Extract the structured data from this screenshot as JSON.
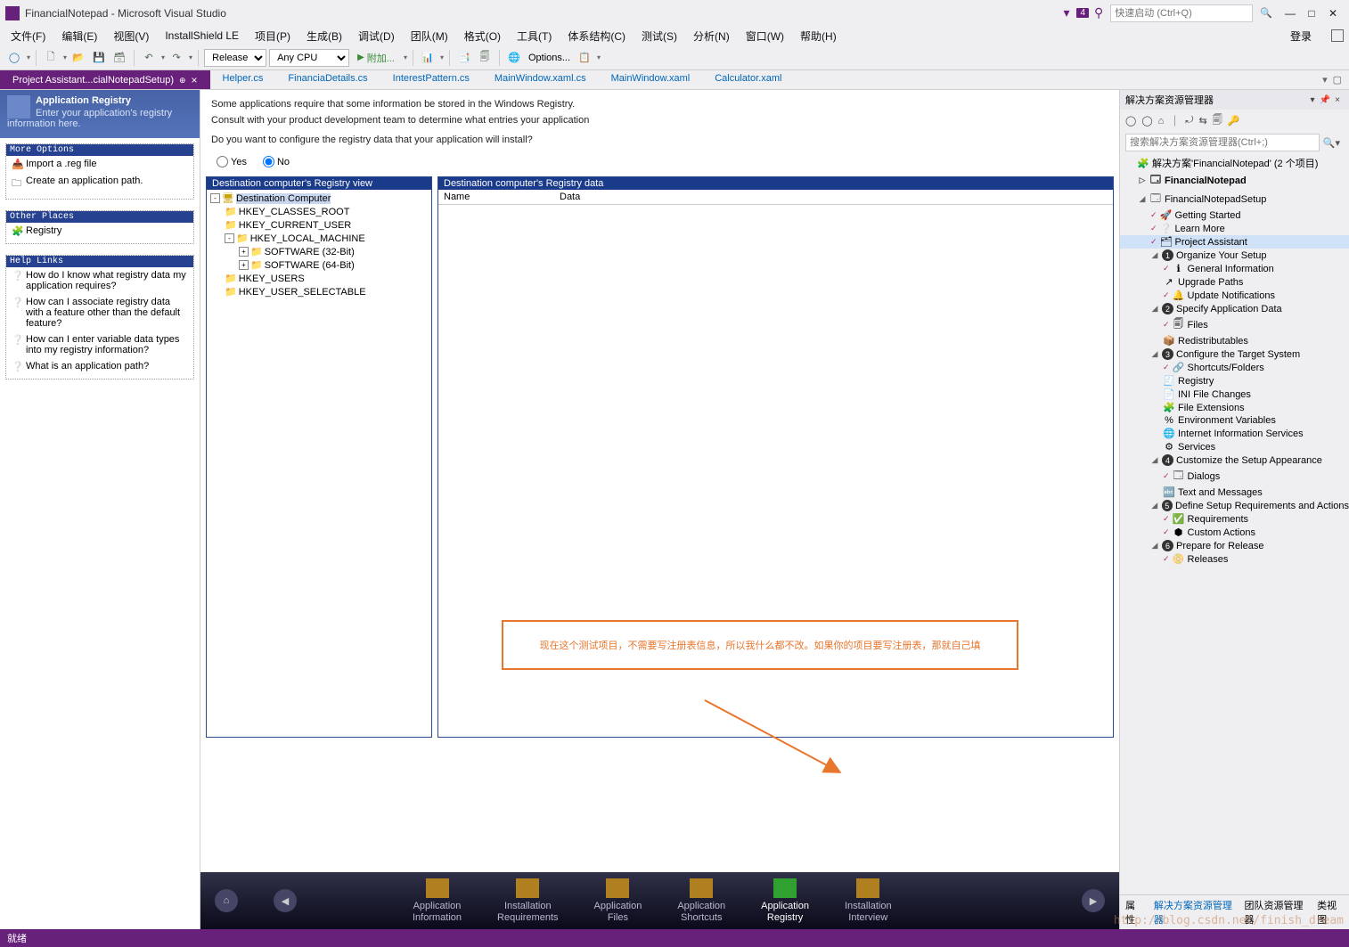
{
  "titlebar": {
    "title": "FinancialNotepad - Microsoft Visual Studio",
    "badge": "4",
    "quicklaunch_placeholder": "快速启动 (Ctrl+Q)"
  },
  "menu": {
    "items": [
      "文件(F)",
      "编辑(E)",
      "视图(V)",
      "InstallShield LE",
      "项目(P)",
      "生成(B)",
      "调试(D)",
      "团队(M)",
      "格式(O)",
      "工具(T)",
      "体系结构(C)",
      "测试(S)",
      "分析(N)",
      "窗口(W)",
      "帮助(H)"
    ],
    "login": "登录"
  },
  "toolbar": {
    "config": "Release",
    "platform": "Any CPU",
    "start": "附加...",
    "options": "Options..."
  },
  "tabs": {
    "active": "Project Assistant...cialNotepadSetup)",
    "others": [
      "Helper.cs",
      "FinanciaDetails.cs",
      "InterestPattern.cs",
      "MainWindow.xaml.cs",
      "MainWindow.xaml",
      "Calculator.xaml"
    ]
  },
  "left": {
    "banner_title": "Application Registry",
    "banner_desc": "Enter your application's registry information here.",
    "more_h": "More Options",
    "more_items": [
      "Import a .reg file",
      "Create an application path."
    ],
    "other_h": "Other Places",
    "other_items": [
      "Registry"
    ],
    "help_h": "Help Links",
    "help_items": [
      "How do I know what registry data my application requires?",
      "How can I associate registry data with a feature other than the default feature?",
      "How can I enter variable data types into my registry information?",
      "What is an application path?"
    ]
  },
  "center": {
    "para1": "Some applications require that some information be stored in the Windows Registry.",
    "para2": "Consult with your product development team to determine what entries your application",
    "question": "Do you want to configure the registry data that your application will install?",
    "yes": "Yes",
    "no": "No",
    "pane1_h": "Destination computer's Registry view",
    "pane2_h": "Destination computer's Registry data",
    "col_name": "Name",
    "col_data": "Data",
    "tree": {
      "root": "Destination Computer",
      "k1": "HKEY_CLASSES_ROOT",
      "k2": "HKEY_CURRENT_USER",
      "k3": "HKEY_LOCAL_MACHINE",
      "k3a": "SOFTWARE (32-Bit)",
      "k3b": "SOFTWARE (64-Bit)",
      "k4": "HKEY_USERS",
      "k5": "HKEY_USER_SELECTABLE"
    },
    "annotation": "现在这个测试项目，不需要写注册表信息，所以我什么都不改。如果你的项目要写注册表，那就自己填"
  },
  "steps": {
    "s1a": "Application",
    "s1b": "Information",
    "s2a": "Installation",
    "s2b": "Requirements",
    "s3a": "Application",
    "s3b": "Files",
    "s4a": "Application",
    "s4b": "Shortcuts",
    "s5a": "Application",
    "s5b": "Registry",
    "s6a": "Installation",
    "s6b": "Interview"
  },
  "right": {
    "title": "解决方案资源管理器",
    "search_placeholder": "搜索解决方案资源管理器(Ctrl+;)",
    "sol": "解决方案'FinancialNotepad' (2 个项目)",
    "proj1": "FinancialNotepad",
    "proj2": "FinancialNotepadSetup",
    "n_getstart": "Getting Started",
    "n_learn": "Learn More",
    "n_pa": "Project Assistant",
    "g1": "Organize Your Setup",
    "g1a": "General Information",
    "g1b": "Upgrade Paths",
    "g1c": "Update Notifications",
    "g2": "Specify Application Data",
    "g2a": "Files",
    "g2b": "Redistributables",
    "g3": "Configure the Target System",
    "g3a": "Shortcuts/Folders",
    "g3b": "Registry",
    "g3c": "INI File Changes",
    "g3d": "File Extensions",
    "g3e": "Environment Variables",
    "g3f": "Internet Information Services",
    "g3g": "Services",
    "g4": "Customize the Setup Appearance",
    "g4a": "Dialogs",
    "g4b": "Text and Messages",
    "g5": "Define Setup Requirements and Actions",
    "g5a": "Requirements",
    "g5b": "Custom Actions",
    "g6": "Prepare for Release",
    "g6a": "Releases",
    "tabs": [
      "属性",
      "解决方案资源管理器",
      "团队资源管理器",
      "类视图"
    ]
  },
  "status": "就绪",
  "watermark": "http://blog.csdn.net/finish_dream"
}
